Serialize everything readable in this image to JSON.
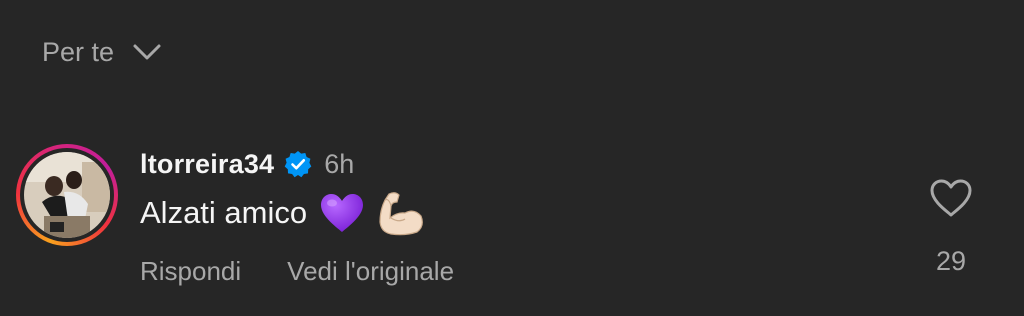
{
  "filter": {
    "label": "Per te",
    "icon": "chevron-down-icon"
  },
  "comment": {
    "username": "ltorreira34",
    "verified": true,
    "time": "6h",
    "text": "Alzati amico",
    "emojis": [
      "purple-heart",
      "flexed-biceps"
    ],
    "actions": {
      "reply": "Rispondi",
      "see_original": "Vedi l'originale"
    },
    "likes": "29"
  },
  "colors": {
    "background": "#262626",
    "primary_text": "#f5f5f5",
    "secondary_text": "#a8a8a8",
    "verified_badge": "#0095f6",
    "heart_emoji": "#9b3cf0"
  }
}
